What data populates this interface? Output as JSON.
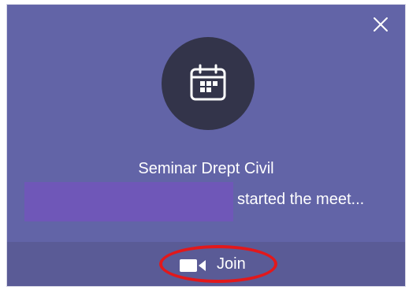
{
  "colors": {
    "toast_background": "#6264a7",
    "action_bar_background": "#5a5b96",
    "avatar_background": "#33344a",
    "redaction": "#6f57b8",
    "highlight_ring": "#e2181b",
    "text": "#ffffff"
  },
  "icons": {
    "close": "close-icon",
    "calendar": "calendar-icon",
    "video": "video-camera-icon"
  },
  "notification": {
    "meeting_title": "Seminar Drept Civil",
    "status_text": "started the meet...",
    "join_label": "Join"
  }
}
